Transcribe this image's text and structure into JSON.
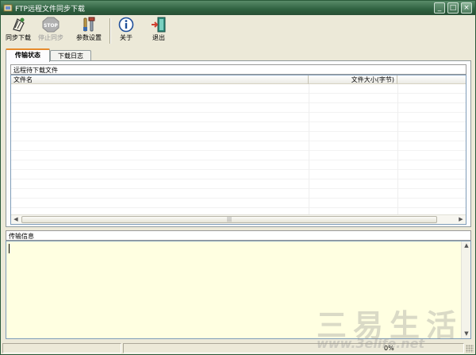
{
  "window": {
    "title": "FTP远程文件同步下载",
    "controls": {
      "minimize": "_",
      "maximize": "□",
      "close": "×"
    }
  },
  "toolbar": {
    "buttons": [
      {
        "label": "同步下载",
        "icon": "sync-download-icon",
        "enabled": true
      },
      {
        "label": "停止同步",
        "icon": "stop-sign-icon",
        "enabled": false,
        "icon_text": "STOP"
      },
      {
        "label": "参数设置",
        "icon": "tools-icon",
        "enabled": true
      },
      {
        "label": "关于",
        "icon": "info-icon",
        "enabled": true
      },
      {
        "label": "退出",
        "icon": "exit-door-icon",
        "enabled": true
      }
    ]
  },
  "tabs": [
    {
      "label": "传输状态",
      "active": true
    },
    {
      "label": "下载日志",
      "active": false
    }
  ],
  "remote_files": {
    "group_title": "远程待下载文件",
    "columns": [
      "文件名",
      "文件大小(字节)"
    ],
    "rows": []
  },
  "transfer_info": {
    "title": "传输信息",
    "text": ""
  },
  "statusbar": {
    "progress_text": "0%"
  },
  "watermark": {
    "text": "三易生活",
    "url": "www.3elife.net"
  },
  "colors": {
    "titlebar": "#2f6140",
    "log_background": "#ffffe1",
    "active_tab_accent": "#e68b2c"
  }
}
